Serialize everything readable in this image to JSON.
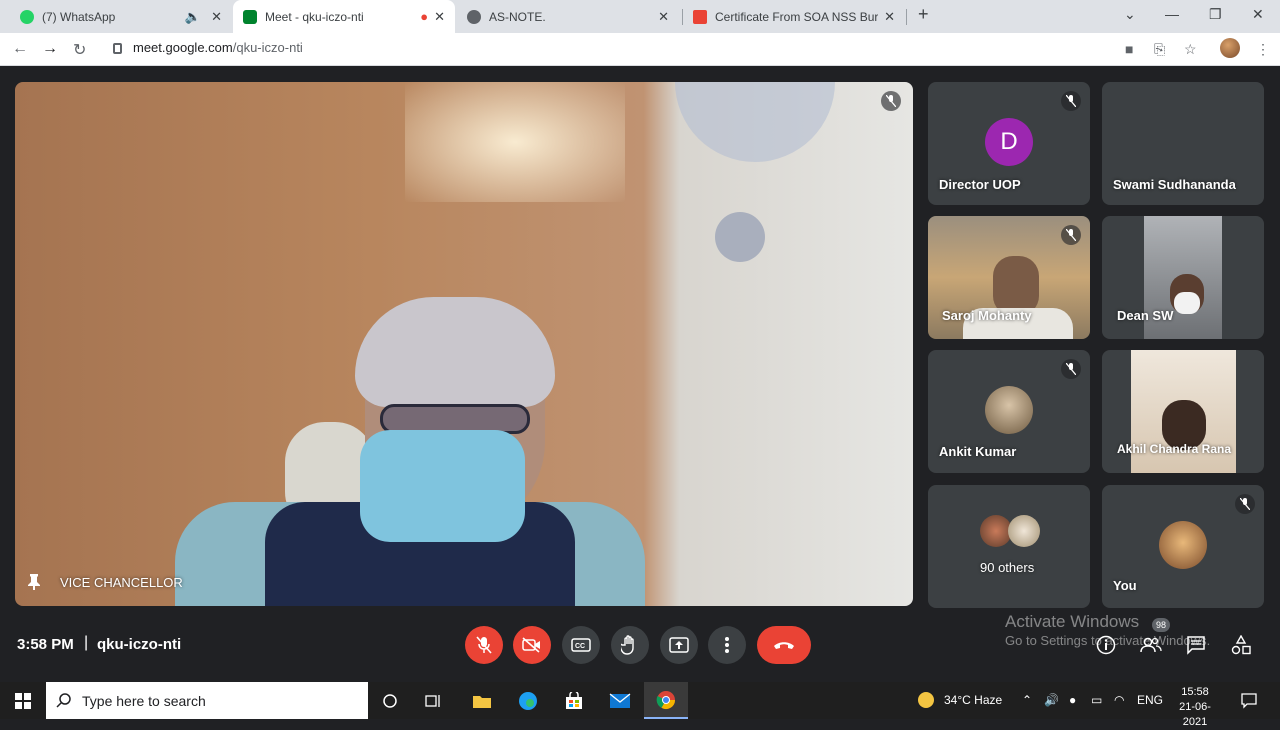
{
  "browser": {
    "tabs": [
      {
        "title": "(7) WhatsApp",
        "favicon": "whatsapp-icon"
      },
      {
        "title": "Meet - qku-iczo-nti",
        "favicon": "meet-icon"
      },
      {
        "title": "AS-NOTE.",
        "favicon": "globe-icon"
      },
      {
        "title": "Certificate From SOA NSS Burea",
        "favicon": "gmail-icon"
      }
    ],
    "url_host": "meet.google.com",
    "url_path": "/qku-iczo-nti"
  },
  "meeting": {
    "main_speaker": "VICE CHANCELLOR",
    "time": "3:58 PM",
    "separator": "|",
    "code": "qku-iczo-nti",
    "participant_count": "98",
    "participants": [
      {
        "name": "Director UOP",
        "initial": "D",
        "muted": true
      },
      {
        "name": "Swami Sudhananda",
        "muted": false
      },
      {
        "name": "Saroj Mohanty",
        "muted": true
      },
      {
        "name": "Dean SW",
        "muted": false
      },
      {
        "name": "Ankit Kumar",
        "muted": true
      },
      {
        "name": "Akhil Chandra Rana",
        "muted": false
      },
      {
        "name": "90 others",
        "muted": false
      },
      {
        "name": "You",
        "muted": true
      }
    ]
  },
  "watermark": {
    "line1": "Activate Windows",
    "line2": "Go to Settings to activate Windows."
  },
  "taskbar": {
    "search_placeholder": "Type here to search",
    "weather": "34°C  Haze",
    "language": "ENG",
    "time": "15:58",
    "date": "21-06-2021"
  },
  "colors": {
    "meet_bg": "#202124",
    "tile_bg": "#3c4043",
    "end_call": "#ea4335",
    "initial_avatar": "#9c27b0"
  }
}
